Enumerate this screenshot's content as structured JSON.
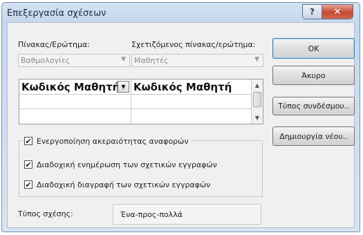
{
  "dialog": {
    "title": "Επεξεργασία σχέσεων",
    "help_glyph": "?",
    "close_glyph": "✕"
  },
  "tables": {
    "left_label": "Πίνακας/Ερώτημα:",
    "right_label": "Σχετιζόμενος πίνακας/ερώτημα:",
    "left_value": "Βαθμολογίες",
    "right_value": "Μαθητές"
  },
  "fields_grid": {
    "left_field": "Κωδικός Μαθητή",
    "right_field": "Κωδικός Μαθητή"
  },
  "options": {
    "enforce_integrity": {
      "label": "Ενεργοποίηση ακεραιότητας αναφορών",
      "checked": true
    },
    "cascade_update": {
      "label": "Διαδοχική ενημέρωση των σχετικών εγγραφών",
      "checked": true
    },
    "cascade_delete": {
      "label": "Διαδοχική διαγραφή των σχετικών εγγραφών",
      "checked": true
    }
  },
  "relationship": {
    "label": "Τύπος σχέσης:",
    "value": "Ένα-προς-πολλά"
  },
  "buttons": {
    "ok": "OK",
    "cancel": "Άκυρο",
    "join_type": "Τύπος συνδέσμου..",
    "create_new": "Δημιουργία νέου.."
  },
  "glyphs": {
    "check": "✔",
    "arrow_down": "▼",
    "arrow_up": "▲"
  },
  "colors": {
    "title_bar": "#c6d8ee",
    "close_button": "#c44b36",
    "dialog_body": "#f0f0f0"
  }
}
